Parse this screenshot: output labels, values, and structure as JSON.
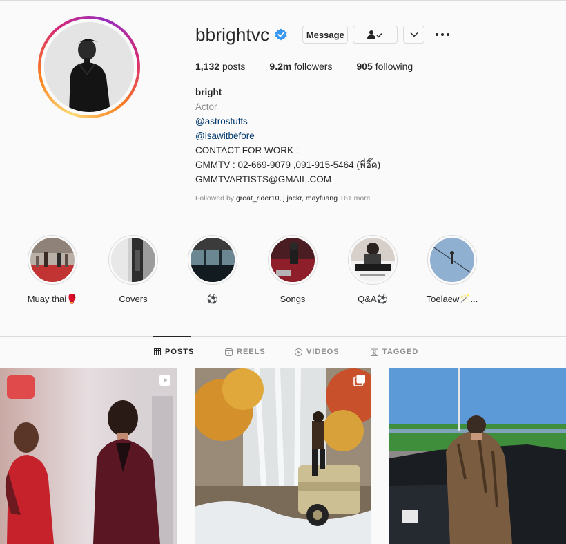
{
  "profile": {
    "username": "bbrightvc",
    "verified_icon": "verified-badge-icon",
    "message_label": "Message",
    "stats": {
      "posts_count": "1,132",
      "posts_label": "posts",
      "followers_count": "9.2m",
      "followers_label": "followers",
      "following_count": "905",
      "following_label": "following"
    },
    "bio": {
      "name": "bright",
      "category": "Actor",
      "link1": "@astrostuffs",
      "link2": "@isawitbefore",
      "line1": "CONTACT FOR WORK :",
      "line2": "GMMTV : 02-669-9079 ,091-915-5464 (พี่อี๊ด)",
      "line3": "GMMTVARTISTS@GMAIL.COM"
    },
    "followed_by": {
      "prefix": "Followed by",
      "names": "great_rider10, j.jackr, mayfuang",
      "more": "+61 more"
    }
  },
  "highlights": [
    {
      "label": "Muay thai🥊"
    },
    {
      "label": "Covers"
    },
    {
      "label": "⚽"
    },
    {
      "label": "Songs"
    },
    {
      "label": "Q&A⚽"
    },
    {
      "label": "Toelaew🪄..."
    }
  ],
  "tabs": {
    "posts": "POSTS",
    "reels": "REELS",
    "videos": "VIDEOS",
    "tagged": "TAGGED"
  },
  "posts": [
    {
      "badge_icon": "reel-icon"
    },
    {
      "badge_icon": "carousel-icon"
    },
    {
      "badge_icon": ""
    }
  ],
  "colors": {
    "link": "#00376b",
    "secondary_text": "#8e8e8e",
    "verified_blue": "#3897f0",
    "border": "#dbdbdb"
  }
}
